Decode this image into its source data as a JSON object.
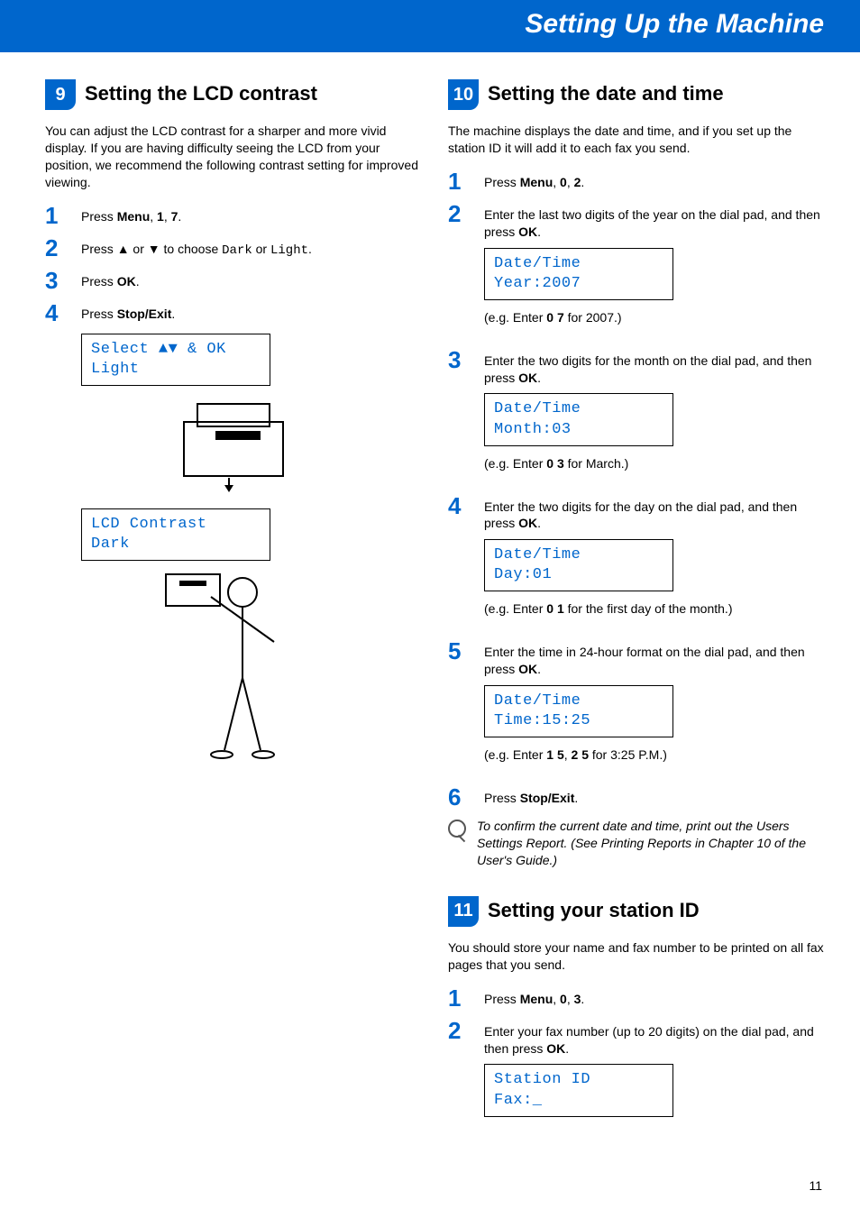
{
  "page_title": "Setting Up the Machine",
  "page_number": "11",
  "sections": {
    "s9": {
      "num": "9",
      "title": "Setting the LCD contrast",
      "intro": "You can adjust the LCD contrast for a sharper and more vivid display. If you are having difficulty seeing the LCD from your position, we recommend the following contrast setting for improved viewing.",
      "steps": {
        "1": {
          "pre": "Press ",
          "b1": "Menu",
          "mid1": ", ",
          "b2": "1",
          "mid2": ", ",
          "b3": "7",
          "post": "."
        },
        "2": {
          "pre": "Press ",
          "mid": " or ",
          "post1": " to choose ",
          "m1": "Dark",
          "post2": " or ",
          "m2": "Light",
          "post3": "."
        },
        "3": {
          "pre": "Press ",
          "b1": "OK",
          "post": "."
        },
        "4": {
          "pre": "Press ",
          "b1": "Stop/Exit",
          "post": "."
        }
      },
      "lcd1": "Select ▲▼ & OK\nLight",
      "lcd2": "LCD Contrast\nDark"
    },
    "s10": {
      "num": "10",
      "title": "Setting the date and time",
      "intro": "The machine displays the date and time, and if you set up the station ID it will add it to each fax you send.",
      "steps": {
        "1": {
          "pre": "Press ",
          "b1": "Menu",
          "mid1": ", ",
          "b2": "0",
          "mid2": ", ",
          "b3": "2",
          "post": "."
        },
        "2": {
          "text1": "Enter the last two digits of the year on the dial pad, and then press ",
          "b1": "OK",
          "post": "."
        },
        "3": {
          "text1": "Enter the two digits for the month on the dial pad, and then press ",
          "b1": "OK",
          "post": "."
        },
        "4": {
          "text1": "Enter the two digits for the day on the dial pad, and then press ",
          "b1": "OK",
          "post": "."
        },
        "5": {
          "text1": "Enter the time in 24-hour format on the dial pad, and then press ",
          "b1": "OK",
          "post": "."
        },
        "6": {
          "pre": "Press ",
          "b1": "Stop/Exit",
          "post": "."
        }
      },
      "lcd_year": "Date/Time\nYear:2007",
      "eg_year_pre": "(e.g. Enter ",
      "eg_year_b": "0 7",
      "eg_year_post": " for 2007.)",
      "lcd_month": "Date/Time\nMonth:03",
      "eg_month_pre": "(e.g. Enter ",
      "eg_month_b": "0 3",
      "eg_month_post": " for March.)",
      "lcd_day": "Date/Time\nDay:01",
      "eg_day_pre": "(e.g. Enter ",
      "eg_day_b": "0 1",
      "eg_day_post": " for the first day of the month.)",
      "lcd_time": "Date/Time\nTime:15:25",
      "eg_time_pre": "(e.g. Enter ",
      "eg_time_b1": "1 5",
      "eg_time_mid": ", ",
      "eg_time_b2": "2 5",
      "eg_time_post": " for 3:25 P.M.)",
      "note": "To confirm the current date and time, print out the Users Settings Report. (See Printing Reports in Chapter 10 of the User's Guide.)"
    },
    "s11": {
      "num": "11",
      "title": "Setting your station ID",
      "intro": "You should store your name and fax number to be printed on all fax pages that you send.",
      "steps": {
        "1": {
          "pre": "Press ",
          "b1": "Menu",
          "mid1": ", ",
          "b2": "0",
          "mid2": ", ",
          "b3": "3",
          "post": "."
        },
        "2": {
          "text1": "Enter your fax number (up to 20 digits) on the dial pad, and then press ",
          "b1": "OK",
          "post": "."
        }
      },
      "lcd_fax": "Station ID\nFax:_"
    }
  }
}
